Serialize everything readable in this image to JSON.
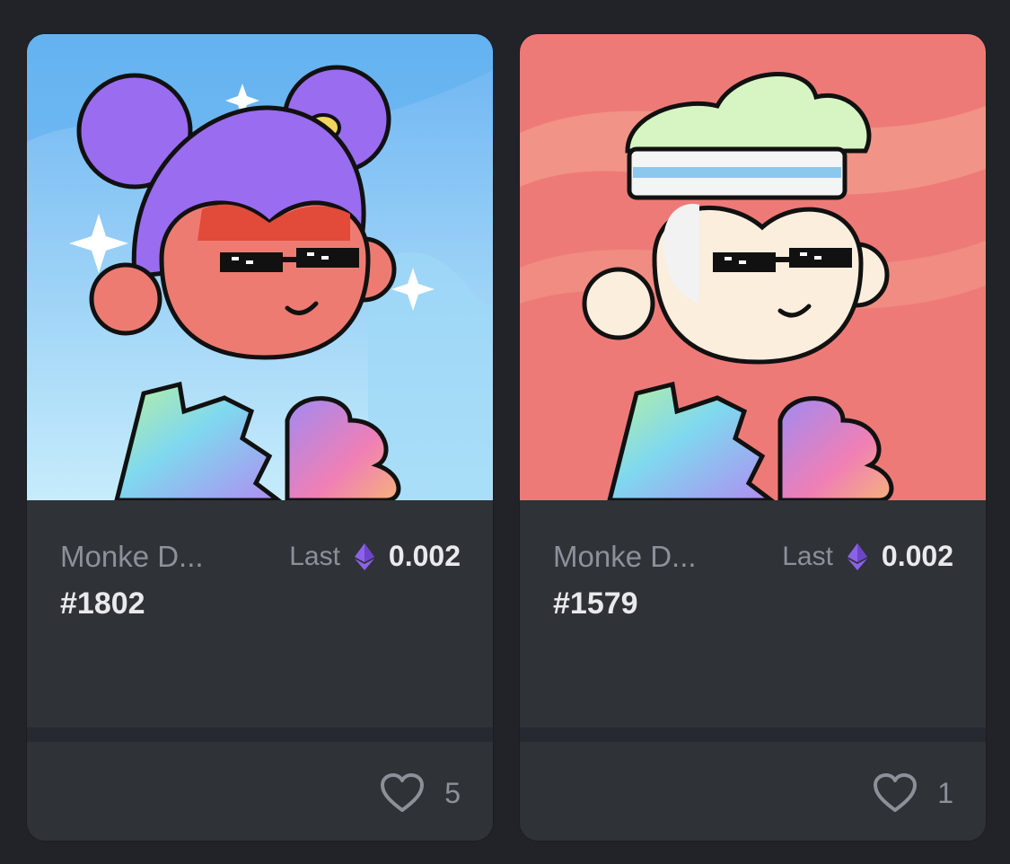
{
  "cards": [
    {
      "collection": "Monke D...",
      "token_id": "#1802",
      "price_label": "Last",
      "price_value": "0.002",
      "price_icon": "ethereum-icon",
      "likes": "5",
      "like_icon": "heart-outline-icon",
      "background_color": "#8fd0f2",
      "hair_color": "#9a6cf0",
      "face_color": "#ee7b72"
    },
    {
      "collection": "Monke D...",
      "token_id": "#1579",
      "price_label": "Last",
      "price_value": "0.002",
      "price_icon": "ethereum-icon",
      "likes": "1",
      "like_icon": "heart-outline-icon",
      "background_color": "#ee7a78",
      "hair_color": "#d6f5c3",
      "face_color": "#fbeedd"
    }
  ]
}
